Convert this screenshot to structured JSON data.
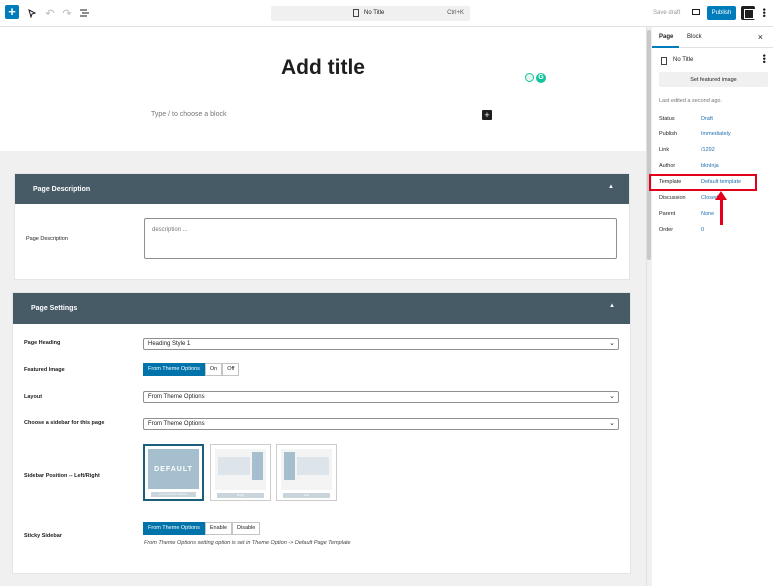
{
  "topbar": {
    "add_block": "+",
    "doc_title": "No Title",
    "shortcut": "Ctrl+K",
    "save_draft": "Save draft",
    "publish": "Publish"
  },
  "editor": {
    "title_placeholder": "Add title",
    "block_placeholder": "Type / to choose a block",
    "block_add": "+",
    "grammarly_letter": "G"
  },
  "page_description_box": {
    "header": "Page Description",
    "field_label": "Page Description",
    "placeholder": "description ..."
  },
  "page_settings_box": {
    "header": "Page Settings",
    "page_heading": {
      "label": "Page Heading",
      "value": "Heading Style 1"
    },
    "featured_image": {
      "label": "Featured Image",
      "options": [
        "From Theme Options",
        "On",
        "Off"
      ],
      "selected": "From Theme Options"
    },
    "layout": {
      "label": "Layout",
      "value": "From Theme Options"
    },
    "sidebar_choice": {
      "label": "Choose a sidebar for this page",
      "value": "From Theme Options"
    },
    "sidebar_position": {
      "label": "Sidebar Position -- Left/Right",
      "default_tile": "DEFAULT",
      "captions": [
        "From Theme Options",
        "Right",
        "Left"
      ]
    },
    "sticky_sidebar": {
      "label": "Sticky Sidebar",
      "options": [
        "From Theme Options",
        "Enable",
        "Disable"
      ],
      "selected": "From Theme Options",
      "note": "From Theme Options setting option is set in Theme Option -> Default Page Template"
    }
  },
  "sidebar": {
    "tabs": [
      "Page",
      "Block"
    ],
    "active_tab": "Page",
    "doc_title": "No Title",
    "featured_button": "Set featured image",
    "last_edited": "Last edited a second ago.",
    "rows": [
      {
        "label": "Status",
        "value": "Draft"
      },
      {
        "label": "Publish",
        "value": "Immediately"
      },
      {
        "label": "Link",
        "value": "/1292"
      },
      {
        "label": "Author",
        "value": "bknInja"
      },
      {
        "label": "Template",
        "value": "Default template"
      },
      {
        "label": "Discussion",
        "value": "Closed"
      },
      {
        "label": "Parent",
        "value": "None"
      },
      {
        "label": "Order",
        "value": "0"
      }
    ]
  },
  "colors": {
    "accent": "#007cba",
    "box_header": "#475b67",
    "highlight": "#e4001b",
    "grammarly": "#15c39a"
  }
}
